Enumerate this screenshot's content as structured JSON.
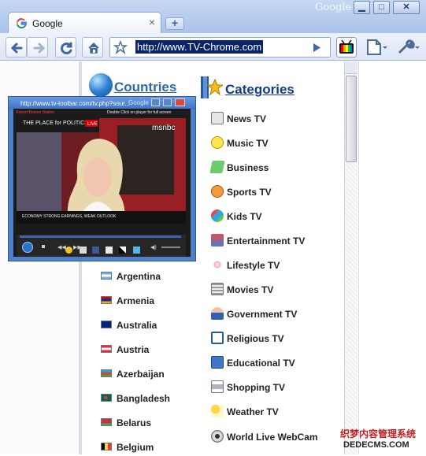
{
  "browser": {
    "tab_title": "Google",
    "brand": "Google",
    "address_url": "http://www.TV-Chrome.com",
    "window_controls": [
      "minimize",
      "maximize",
      "close"
    ]
  },
  "headings": {
    "countries": "Countries",
    "categories": "Categories"
  },
  "categories": [
    {
      "label": "News TV",
      "icon": "news-icon"
    },
    {
      "label": "Music TV",
      "icon": "music-icon"
    },
    {
      "label": "Business",
      "icon": "business-icon"
    },
    {
      "label": "Sports TV",
      "icon": "sports-icon"
    },
    {
      "label": "Kids TV",
      "icon": "kids-icon"
    },
    {
      "label": "Entertainment TV",
      "icon": "entertainment-icon"
    },
    {
      "label": "Lifestyle TV",
      "icon": "lifestyle-icon"
    },
    {
      "label": "Movies TV",
      "icon": "movies-icon"
    },
    {
      "label": "Government TV",
      "icon": "government-icon"
    },
    {
      "label": "Religious TV",
      "icon": "religious-icon"
    },
    {
      "label": "Educational TV",
      "icon": "educational-icon"
    },
    {
      "label": "Shopping TV",
      "icon": "shopping-icon"
    },
    {
      "label": "Weather TV",
      "icon": "weather-icon"
    },
    {
      "label": "World Live WebCam",
      "icon": "webcam-icon"
    }
  ],
  "countries": [
    {
      "label": "Argentina",
      "flag": "argentina-flag"
    },
    {
      "label": "Armenia",
      "flag": "armenia-flag"
    },
    {
      "label": "Australia",
      "flag": "australia-flag"
    },
    {
      "label": "Austria",
      "flag": "austria-flag"
    },
    {
      "label": "Azerbaijan",
      "flag": "azerbaijan-flag"
    },
    {
      "label": "Bangladesh",
      "flag": "bangladesh-flag"
    },
    {
      "label": "Belarus",
      "flag": "belarus-flag"
    },
    {
      "label": "Belgium",
      "flag": "belgium-flag"
    }
  ],
  "player": {
    "url": "http://www.tv-toolbar.com/tv.php?sour...",
    "google": "Google",
    "report": "Report Broken Station",
    "hint": "Double Click on player for full screen",
    "show": "THE PLACE for POLITICS",
    "network": "msnbc",
    "live": "LIVE",
    "ticker": "ECONOMY  STRONG EARNINGS, WEAK OUTLOOK"
  },
  "watermark": {
    "line1": "织梦内容管理系统",
    "line2": "DEDECMS.COM"
  },
  "colors": {
    "chrome_blue": "#aac3ea",
    "link_blue": "#123c86",
    "countries_blue": "#2d69a9",
    "url_selection": "#0a246a"
  }
}
